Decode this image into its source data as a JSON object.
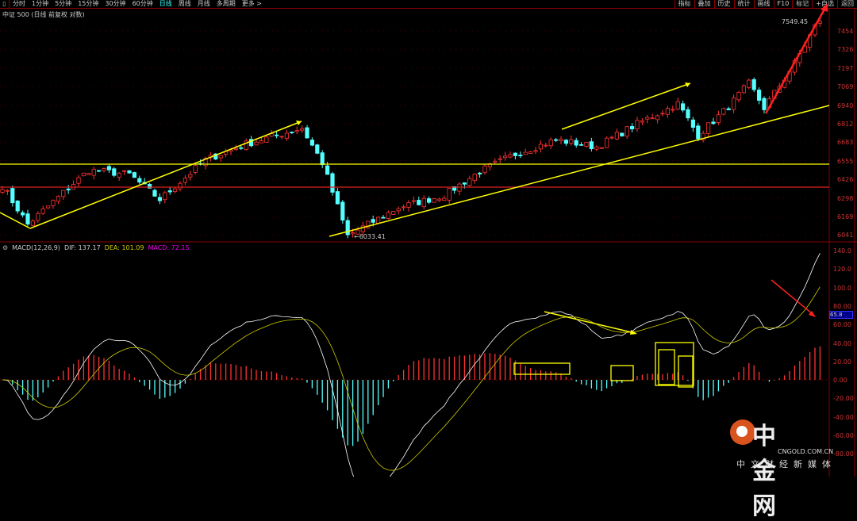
{
  "toolbar": {
    "periods": [
      "分时",
      "1分钟",
      "5分钟",
      "15分钟",
      "30分钟",
      "60分钟",
      "日线",
      "周线",
      "月线",
      "多周期",
      "更多 >"
    ],
    "active": "日线",
    "right": [
      "指标",
      "叠加",
      "历史",
      "统计",
      "画线",
      "F10",
      "标记",
      "+自选",
      "返回"
    ]
  },
  "title": "中证 500 (日线 前复权 对数)",
  "price_axis": [
    "7454",
    "7326",
    "7197",
    "7069",
    "6940",
    "6812",
    "6683",
    "6555",
    "6426",
    "6298",
    "6169",
    "6041"
  ],
  "max_label": "7549.45",
  "min_label": "6033.41",
  "macd": {
    "name": "MACD(12,26,9)",
    "dif": "DIF: 137.17",
    "dea": "DEA: 101.09",
    "macd": "MACD: 72.15",
    "current": "65.8",
    "axis": [
      "140.0",
      "120.0",
      "100.0",
      "80.00",
      "60.00",
      "40.00",
      "20.00",
      "0.00",
      "-20.00",
      "-40.00",
      "-60.00",
      "-80.00"
    ]
  },
  "watermark": {
    "name": "中金网",
    "url": "CNGOLD.COM.CN",
    "tagline": "中文财经新媒体"
  },
  "colors": {
    "up": "#ff3232",
    "down": "#54ffff",
    "dif": "#ffffff",
    "dea": "#cccc00",
    "trend": "#ffff00",
    "signal": "#ff2020"
  },
  "chart_data": {
    "type": "candlestick",
    "candles": 162,
    "price_waypoints": [
      [
        0,
        6380
      ],
      [
        5,
        6113
      ],
      [
        17,
        6490
      ],
      [
        25,
        6460
      ],
      [
        31,
        6285
      ],
      [
        40,
        6560
      ],
      [
        48,
        6670
      ],
      [
        59,
        6780
      ],
      [
        63,
        6540
      ],
      [
        68,
        6034
      ],
      [
        78,
        6230
      ],
      [
        87,
        6315
      ],
      [
        94,
        6480
      ],
      [
        101,
        6600
      ],
      [
        109,
        6700
      ],
      [
        117,
        6650
      ],
      [
        125,
        6810
      ],
      [
        133,
        6950
      ],
      [
        137,
        6730
      ],
      [
        143,
        6930
      ],
      [
        147,
        7090
      ],
      [
        150,
        6920
      ],
      [
        156,
        7230
      ],
      [
        161,
        7549
      ]
    ],
    "ylim": [
      6033.41,
      7549.45
    ],
    "macd_ylim": [
      -80,
      140
    ]
  }
}
